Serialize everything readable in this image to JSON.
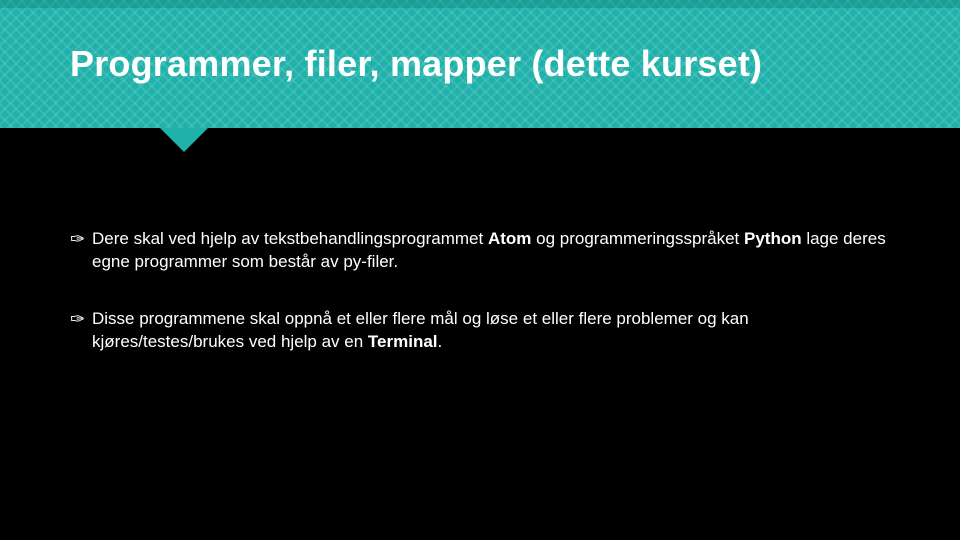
{
  "slide": {
    "title": "Programmer, filer, mapper (dette kurset)",
    "bullets": [
      {
        "pre": "Dere skal ved hjelp av tekstbehandlingsprogrammet ",
        "b1": "Atom",
        "mid": " og programmeringsspråket ",
        "b2": "Python",
        "post": " lage deres egne programmer som består av py-filer."
      },
      {
        "pre": "Disse programmene skal oppnå et eller flere mål og løse et eller flere problemer og kan kjøres/testes/brukes ved hjelp av en ",
        "b1": "Terminal",
        "mid": "",
        "b2": "",
        "post": "."
      }
    ],
    "bullet_glyph": "✑"
  }
}
